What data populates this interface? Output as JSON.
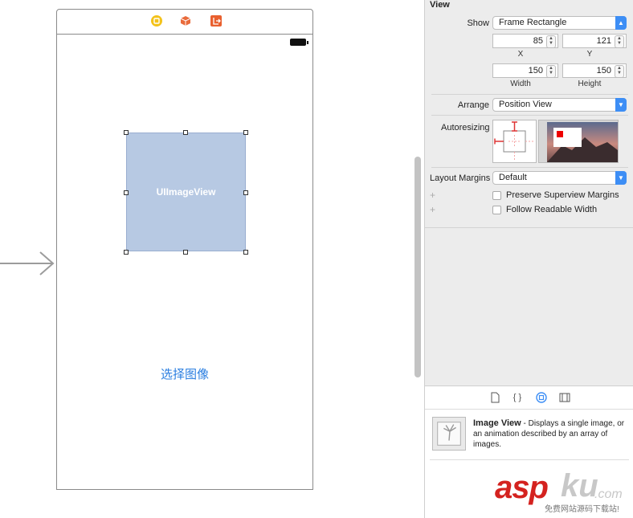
{
  "canvas": {
    "image_view_label": "UIImageView",
    "select_image_button": "选择图像"
  },
  "inspector": {
    "section_title": "View",
    "show": {
      "label": "Show",
      "value": "Frame Rectangle"
    },
    "frame": {
      "x": {
        "label": "X",
        "value": "85"
      },
      "y": {
        "label": "Y",
        "value": "121"
      },
      "width": {
        "label": "Width",
        "value": "150"
      },
      "height": {
        "label": "Height",
        "value": "150"
      }
    },
    "arrange": {
      "label": "Arrange",
      "value": "Position View"
    },
    "autoresizing": {
      "label": "Autoresizing"
    },
    "layout_margins": {
      "label": "Layout Margins",
      "value": "Default"
    },
    "checkboxes": [
      {
        "label": "Preserve Superview Margins",
        "checked": false
      },
      {
        "label": "Follow Readable Width",
        "checked": false
      }
    ]
  },
  "library": {
    "tabs": [
      "file-icon",
      "braces-icon",
      "object-library-icon",
      "media-library-icon"
    ],
    "selected_tab": "object-library-icon",
    "item": {
      "title": "Image View",
      "description": " - Displays a single image, or an animation described by an array of images."
    }
  },
  "watermark": {
    "brand_red": "asp",
    "brand_gray": "ku",
    "suffix": ".com",
    "subtitle": "免费网站源码下载站!"
  },
  "colors": {
    "accent": "#3d8ef5",
    "image_view_fill": "#b7c9e3",
    "link": "#2a7ee0",
    "watermark_red": "#d4221f"
  }
}
